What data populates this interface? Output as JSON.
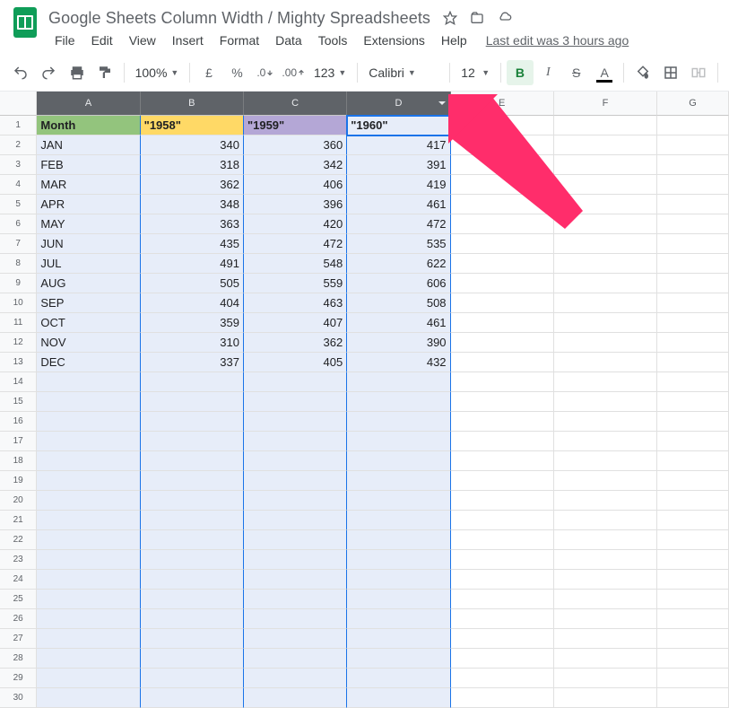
{
  "doc_title": "Google Sheets Column Width / Mighty Spreadsheets",
  "last_edit": "Last edit was 3 hours ago",
  "menu": [
    "File",
    "Edit",
    "View",
    "Insert",
    "Format",
    "Data",
    "Tools",
    "Extensions",
    "Help"
  ],
  "toolbar": {
    "zoom": "100%",
    "currency": "£",
    "percent": "%",
    "dec_dec": ".0",
    "inc_dec": ".00",
    "num_format": "123",
    "font": "Calibri",
    "font_size": "12",
    "bold": "B",
    "italic": "I",
    "strike": "S",
    "text_color": "A"
  },
  "columns": [
    "A",
    "B",
    "C",
    "D",
    "E",
    "F",
    "G"
  ],
  "headers": {
    "month": "Month",
    "y1958": "\"1958\"",
    "y1959": "\"1959\"",
    "y1960": "\"1960\""
  },
  "rows": [
    {
      "m": "JAN",
      "a": "340",
      "b": "360",
      "c": "417"
    },
    {
      "m": "FEB",
      "a": "318",
      "b": "342",
      "c": "391"
    },
    {
      "m": "MAR",
      "a": "362",
      "b": "406",
      "c": "419"
    },
    {
      "m": "APR",
      "a": "348",
      "b": "396",
      "c": "461"
    },
    {
      "m": "MAY",
      "a": "363",
      "b": "420",
      "c": "472"
    },
    {
      "m": "JUN",
      "a": "435",
      "b": "472",
      "c": "535"
    },
    {
      "m": "JUL",
      "a": "491",
      "b": "548",
      "c": "622"
    },
    {
      "m": "AUG",
      "a": "505",
      "b": "559",
      "c": "606"
    },
    {
      "m": "SEP",
      "a": "404",
      "b": "463",
      "c": "508"
    },
    {
      "m": "OCT",
      "a": "359",
      "b": "407",
      "c": "461"
    },
    {
      "m": "NOV",
      "a": "310",
      "b": "362",
      "c": "390"
    },
    {
      "m": "DEC",
      "a": "337",
      "b": "405",
      "c": "432"
    }
  ],
  "row_numbers": [
    "1",
    "2",
    "3",
    "4",
    "5",
    "6",
    "7",
    "8",
    "9",
    "10",
    "11",
    "12",
    "13",
    "14",
    "15",
    "16",
    "17",
    "18",
    "19",
    "20",
    "21",
    "22",
    "23",
    "24",
    "25",
    "26",
    "27",
    "28",
    "29",
    "30"
  ]
}
